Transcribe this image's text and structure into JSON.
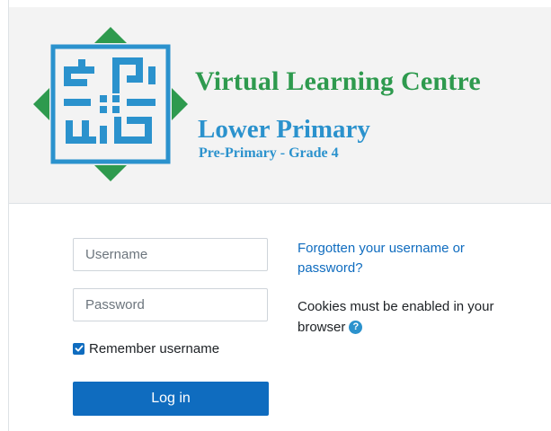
{
  "header": {
    "title": "Virtual Learning Centre",
    "subtitle": "Lower Primary",
    "grade_range": "Pre-Primary - Grade 4",
    "colors": {
      "green": "#2e9a4e",
      "blue": "#2b92cd"
    }
  },
  "login_form": {
    "username": {
      "placeholder": "Username",
      "value": ""
    },
    "password": {
      "placeholder": "Password",
      "value": ""
    },
    "remember": {
      "label": "Remember username",
      "checked": true
    },
    "login_button": "Log in",
    "accent_color": "#0f6cbf"
  },
  "help": {
    "forgot_link": "Forgotten your username or password?",
    "cookies_text": "Cookies must be enabled in your browser",
    "help_icon": "question-mark-icon"
  }
}
